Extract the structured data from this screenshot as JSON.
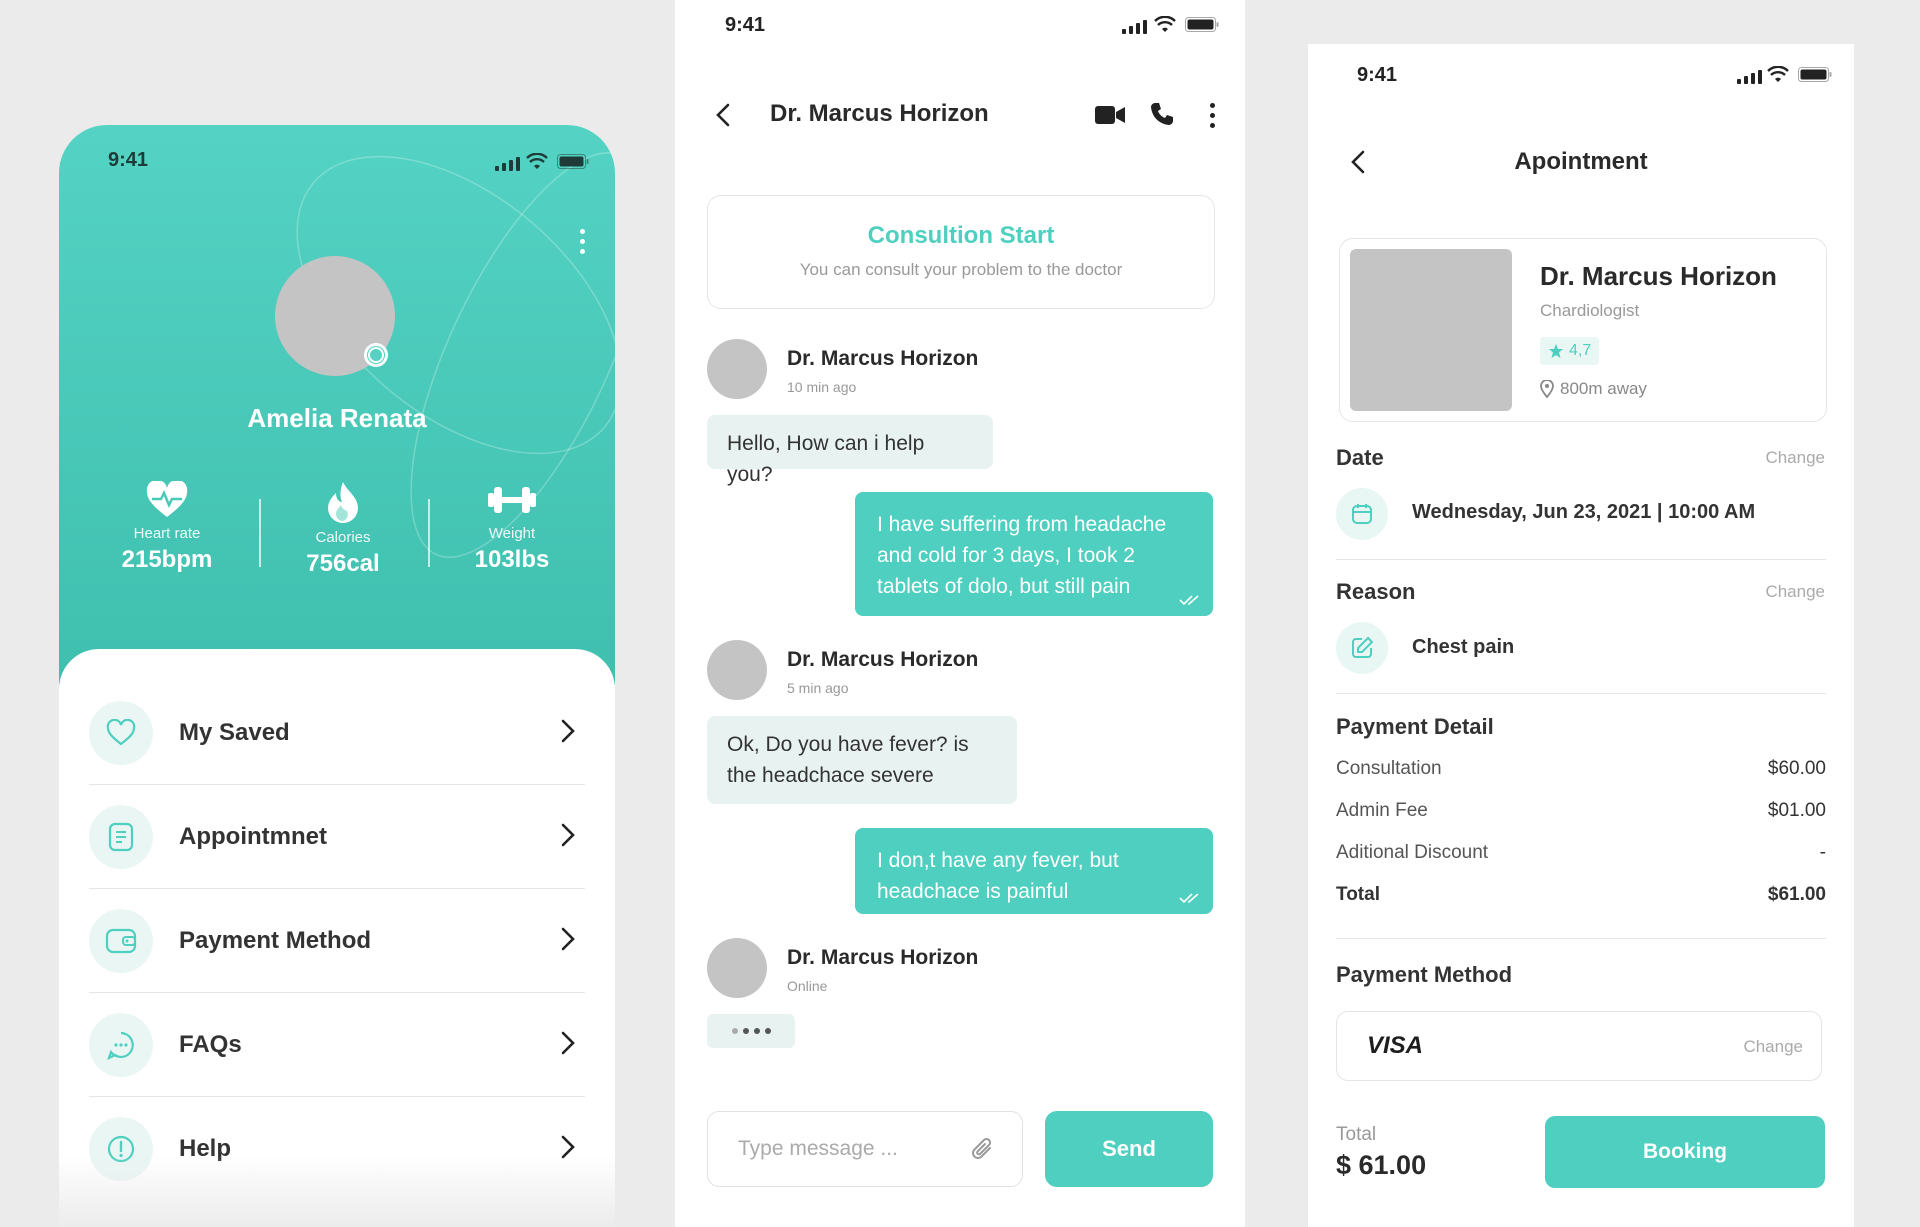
{
  "status": {
    "time": "9:41"
  },
  "profile": {
    "name": "Amelia Renata",
    "stats": [
      {
        "label": "Heart rate",
        "value": "215bpm",
        "icon": "heart-pulse-icon"
      },
      {
        "label": "Calories",
        "value": "756cal",
        "icon": "flame-icon"
      },
      {
        "label": "Weight",
        "value": "103lbs",
        "icon": "dumbbell-icon"
      }
    ],
    "menu": [
      {
        "label": "My Saved",
        "icon": "heart-icon"
      },
      {
        "label": "Appointmnet",
        "icon": "document-icon"
      },
      {
        "label": "Payment Method",
        "icon": "wallet-icon"
      },
      {
        "label": "FAQs",
        "icon": "chat-bubble-icon"
      },
      {
        "label": "Help",
        "icon": "alert-circle-icon"
      }
    ]
  },
  "chat": {
    "title": "Dr. Marcus Horizon",
    "consult_title": "Consultion Start",
    "consult_subtitle": "You can consult your problem to the doctor",
    "messages": [
      {
        "name": "Dr. Marcus Horizon",
        "time": "10 min ago",
        "text": "Hello, How can i help you?"
      },
      {
        "text": "I have suffering from headache and cold for 3 days, I took 2 tablets of dolo, but still pain"
      },
      {
        "name": "Dr. Marcus Horizon",
        "time": "5 min ago",
        "text": "Ok, Do you have fever? is the headchace severe"
      },
      {
        "text": "I don,t have any fever, but headchace is painful"
      },
      {
        "name": "Dr. Marcus Horizon",
        "time": "Online"
      }
    ],
    "input_placeholder": "Type message ...",
    "send_label": "Send"
  },
  "appointment": {
    "title": "Apointment",
    "doctor": {
      "name": "Dr. Marcus Horizon",
      "specialty": "Chardiologist",
      "rating": "4,7",
      "distance": "800m away"
    },
    "date_title": "Date",
    "date_value": "Wednesday, Jun 23, 2021 | 10:00 AM",
    "reason_title": "Reason",
    "reason_value": "Chest pain",
    "change_label": "Change",
    "payment_title": "Payment Detail",
    "payment_rows": [
      {
        "label": "Consultation",
        "value": "$60.00"
      },
      {
        "label": "Admin Fee",
        "value": "$01.00"
      },
      {
        "label": "Aditional Discount",
        "value": "-"
      },
      {
        "label": "Total",
        "value": "$61.00"
      }
    ],
    "method_title": "Payment Method",
    "method_value": "VISA",
    "total_label": "Total",
    "total_value": "$ 61.00",
    "booking_label": "Booking"
  },
  "colors": {
    "accent": "#4fcfbf",
    "accent_light": "#e8f6f4",
    "placeholder_gray": "#c4c4c4"
  }
}
